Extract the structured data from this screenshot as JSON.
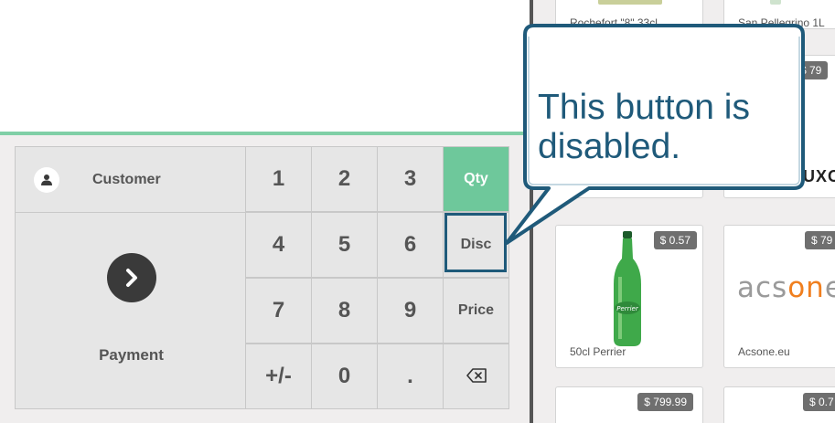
{
  "customer": {
    "label": "Customer",
    "icon": "user-icon"
  },
  "payment": {
    "label": "Payment",
    "icon": "chevron-right-icon"
  },
  "numpad": {
    "keys": [
      "1",
      "2",
      "3",
      "4",
      "5",
      "6",
      "7",
      "8",
      "9",
      "+/-",
      "0",
      "."
    ],
    "modes": {
      "qty": "Qty",
      "disc": "Disc",
      "price": "Price"
    },
    "backspace_icon": "backspace-icon",
    "selected_mode_color": "#6ec89b"
  },
  "products": [
    {
      "name": "Rochefort \"8\" 33cl",
      "price": ""
    },
    {
      "name": "San Pellegrino 1L",
      "price": ""
    },
    {
      "name": "",
      "price": "$ 79"
    },
    {
      "name": "",
      "price": "$ 79"
    },
    {
      "name": "50cl Perrier",
      "price": "$ 0.57"
    },
    {
      "name": "Acsone.eu",
      "price": "$ 79"
    },
    {
      "name": "",
      "price": "$ 799.99"
    },
    {
      "name": "",
      "price": "$ 0.7"
    }
  ],
  "logos": {
    "auxo": "AUXO",
    "acsone": "acsone"
  },
  "tooltip": {
    "text_line1": "This button is",
    "text_line2": "disabled.",
    "accent": "#1f5a7a"
  }
}
